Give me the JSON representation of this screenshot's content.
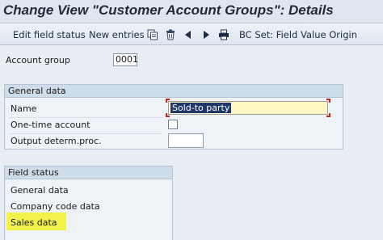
{
  "window": {
    "title": "Change View \"Customer Account Groups\": Details"
  },
  "toolbar": {
    "edit_field_status": "Edit field status",
    "new_entries": "New entries",
    "copy_icon": "copy-icon",
    "delete_icon": "trash-icon",
    "prev_icon": "triangle-left-icon",
    "next_icon": "triangle-right-icon",
    "print_icon": "printer-icon",
    "bc_set": "BC Set: Field Value Origin"
  },
  "account_group": {
    "label": "Account group",
    "value": "0001"
  },
  "general_data": {
    "title": "General data",
    "name_label": "Name",
    "name_value": "Sold-to party",
    "one_time_label": "One-time account",
    "one_time_checked": false,
    "output_label": "Output determ.proc.",
    "output_value": ""
  },
  "field_status": {
    "title": "Field status",
    "items": [
      "General data",
      "Company code data",
      "Sales data"
    ],
    "highlight_color": "#f2f24a"
  }
}
